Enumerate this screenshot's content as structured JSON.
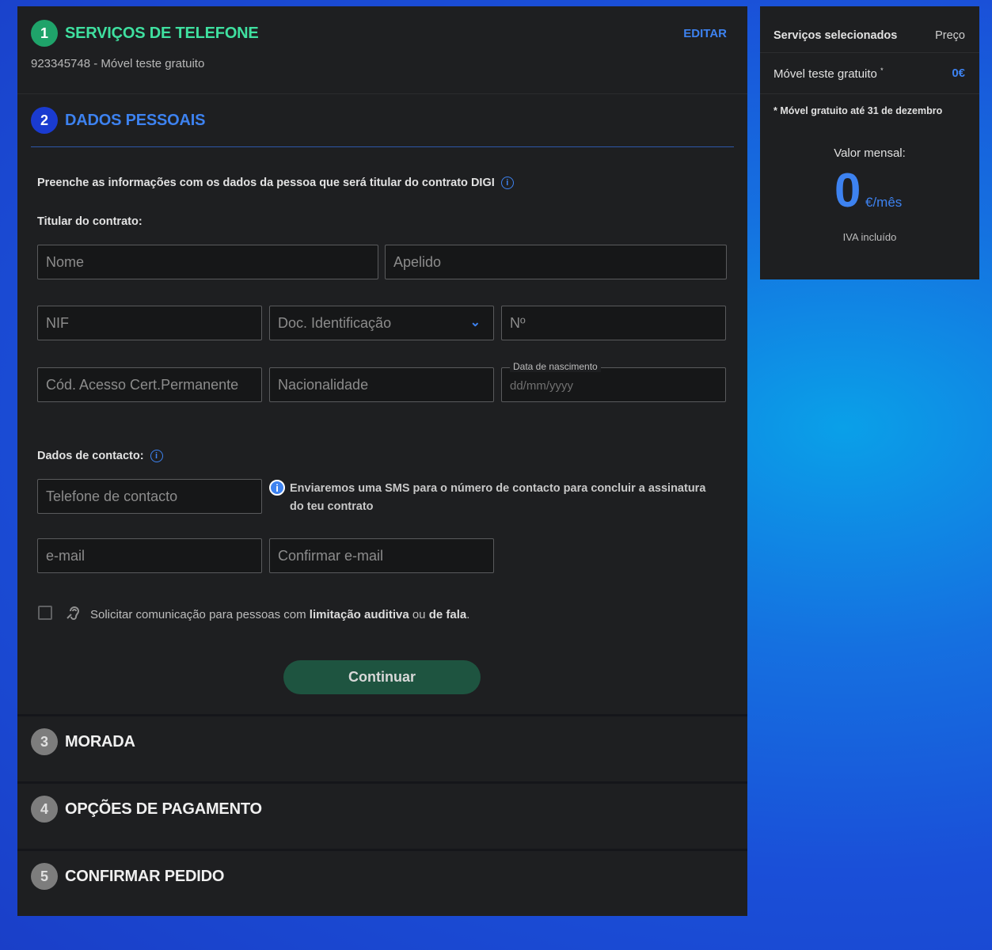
{
  "step1": {
    "number": "1",
    "title": "SERVIÇOS DE TELEFONE",
    "edit_label": "EDITAR",
    "subtitle": "923345748 - Móvel teste gratuito"
  },
  "step2": {
    "number": "2",
    "title": "DADOS PESSOAIS",
    "intro": "Preenche as informações com os dados da pessoa que será titular do contrato DIGI",
    "holder_label": "Titular do contrato:",
    "fields": {
      "nome": "Nome",
      "apelido": "Apelido",
      "nif": "NIF",
      "doc_id": "Doc. Identificação",
      "numero": "Nº",
      "cod_acesso": "Cód. Acesso Cert.Permanente",
      "nacionalidade": "Nacionalidade",
      "data_nascimento_label": "Data de nascimento",
      "data_nascimento_placeholder": "dd/mm/yyyy"
    },
    "contact_label": "Dados de contacto:",
    "contact_fields": {
      "telefone": "Telefone de contacto",
      "email": "e-mail",
      "confirm_email": "Confirmar e-mail"
    },
    "sms_note": "Enviaremos uma SMS para o número de contacto para concluir a assinatura do teu contrato",
    "accessibility": {
      "prefix": "Solicitar comunicação para pessoas com ",
      "bold1": "limitação auditiva",
      "middle": " ou ",
      "bold2": "de fala",
      "suffix": "."
    },
    "continue_label": "Continuar"
  },
  "step3": {
    "number": "3",
    "title": "MORADA"
  },
  "step4": {
    "number": "4",
    "title": "OPÇÕES DE PAGAMENTO"
  },
  "step5": {
    "number": "5",
    "title": "CONFIRMAR PEDIDO"
  },
  "summary": {
    "col_services": "Serviços selecionados",
    "col_price": "Preço",
    "service_name": "Móvel teste gratuito",
    "service_mark": "*",
    "service_price": "0€",
    "footnote": "* Móvel gratuito até 31 de dezembro",
    "monthly_label": "Valor mensal:",
    "monthly_value": "0",
    "monthly_unit": "€/mês",
    "tax_note": "IVA incluído"
  },
  "colors": {
    "accent_blue": "#3d82f0",
    "accent_green": "#3fe0a0",
    "button_bg": "#1e5440"
  }
}
